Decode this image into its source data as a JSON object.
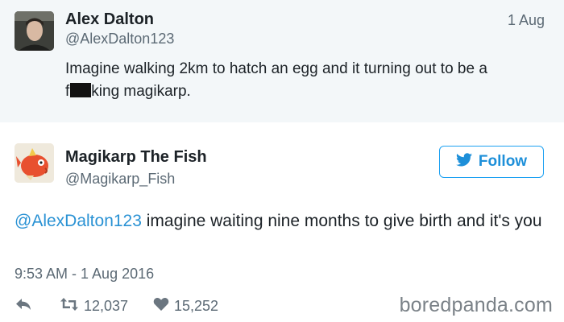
{
  "tweet1": {
    "name": "Alex Dalton",
    "handle": "@AlexDalton123",
    "date": "1 Aug",
    "text_line1": "Imagine walking 2km to hatch an egg and it turning out to be a",
    "text_f": "f",
    "text_line2_rest": "king magikarp."
  },
  "tweet2": {
    "name": "Magikarp The Fish",
    "handle": "@Magikarp_Fish",
    "follow_label": "Follow",
    "mention": "@AlexDalton123",
    "text": " imagine waiting nine months to give birth and it's you",
    "timestamp": "9:53 AM - 1 Aug 2016",
    "retweets": "12,037",
    "likes": "15,252"
  },
  "watermark": "boredpanda.com",
  "colors": {
    "link": "#2a92d4",
    "follow": "#1da1f2",
    "muted": "#5c6a75",
    "top_background": "#f3f7f9"
  }
}
